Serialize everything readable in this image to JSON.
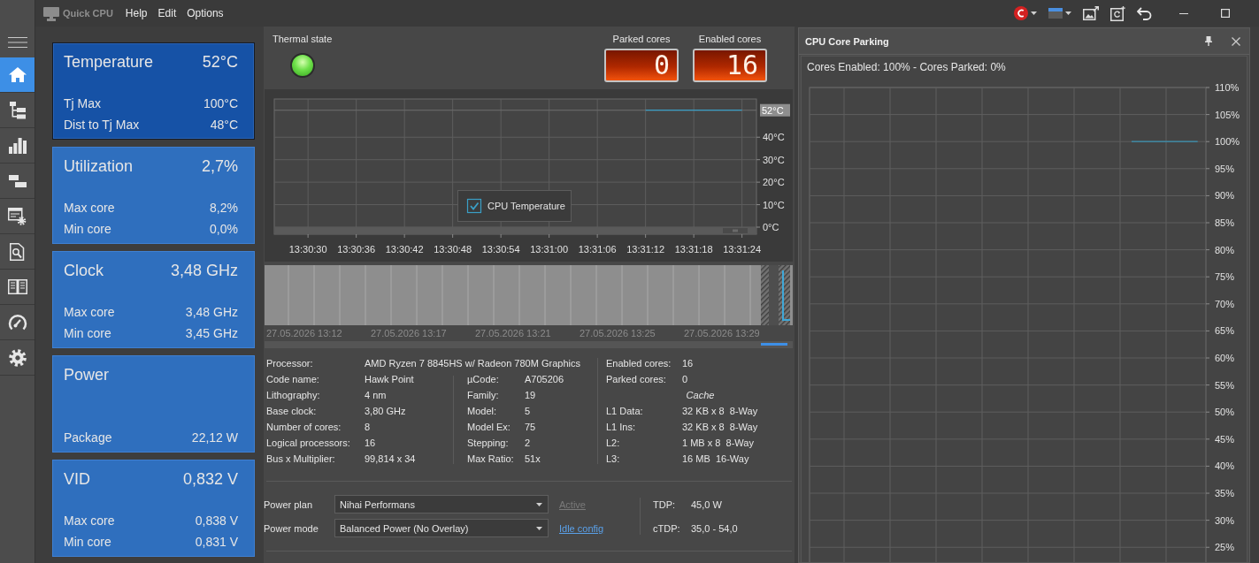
{
  "window": {
    "app_name": "Quick CPU",
    "menu": [
      "Help",
      "Edit",
      "Options"
    ]
  },
  "sidebar": {
    "items": [
      {
        "kind": "home",
        "selected": true
      },
      {
        "kind": "tree",
        "selected": false
      },
      {
        "kind": "chart",
        "selected": false
      },
      {
        "kind": "layers",
        "selected": false
      },
      {
        "kind": "report",
        "selected": false
      },
      {
        "kind": "inspect",
        "selected": false
      },
      {
        "kind": "compare",
        "selected": false
      },
      {
        "kind": "gauge",
        "selected": false
      },
      {
        "kind": "settings",
        "selected": false
      }
    ]
  },
  "cards": [
    {
      "title": "Temperature",
      "value": "52°C",
      "selected": true,
      "rows": [
        {
          "label": "Tj Max",
          "value": "100°C"
        },
        {
          "label": "Dist to Tj Max",
          "value": "48°C"
        }
      ]
    },
    {
      "title": "Utilization",
      "value": "2,7%",
      "selected": false,
      "rows": [
        {
          "label": "Max core",
          "value": "8,2%"
        },
        {
          "label": "Min core",
          "value": "0,0%"
        }
      ]
    },
    {
      "title": "Clock",
      "value": "3,48 GHz",
      "selected": false,
      "rows": [
        {
          "label": "Max core",
          "value": "3,48 GHz"
        },
        {
          "label": "Min core",
          "value": "3,45 GHz"
        }
      ]
    },
    {
      "title": "Power",
      "selected": false,
      "rows": [
        {
          "label": "Package",
          "value": "22,12 W"
        }
      ]
    },
    {
      "title": "VID",
      "value": "0,832 V",
      "selected": false,
      "rows": [
        {
          "label": "Max core",
          "value": "0,838 V"
        },
        {
          "label": "Min core",
          "value": "0,831 V"
        }
      ]
    }
  ],
  "thermal_state": {
    "label": "Thermal state",
    "overheated": false
  },
  "counters": [
    {
      "label": "Parked cores",
      "value": "0"
    },
    {
      "label": "Enabled cores",
      "value": "16"
    }
  ],
  "temperature_chart": {
    "legend_checked": true,
    "chart_data": {
      "type": "line",
      "categories": [
        "13:30:30",
        "13:30:36",
        "13:30:42",
        "13:30:48",
        "13:30:54",
        "13:31:00",
        "13:31:06",
        "13:31:12",
        "13:31:18",
        "13:31:24"
      ],
      "series": [
        {
          "name": "CPU Temperature",
          "color": "#3a9fc6",
          "values": [
            null,
            null,
            null,
            null,
            null,
            null,
            null,
            52,
            52,
            52
          ]
        }
      ],
      "ylim": [
        0,
        57
      ],
      "yticks": [
        {
          "value": 0,
          "label": "0°C"
        },
        {
          "value": 10,
          "label": "10°C"
        },
        {
          "value": 20,
          "label": "20°C"
        },
        {
          "value": 30,
          "label": "30°C"
        },
        {
          "value": 40,
          "label": "40°C"
        }
      ],
      "grid": true,
      "ref_lines": [
        {
          "axis": "y",
          "value": 52
        }
      ],
      "annotations": [
        "52°C"
      ]
    }
  },
  "overview": {
    "date_labels": [
      "27.05.2026 13:12",
      "27.05.2026 13:17",
      "27.05.2026 13:21",
      "27.05.2026 13:25",
      "27.05.2026 13:29"
    ]
  },
  "processor_info": {
    "processor": {
      "label": "Processor:",
      "value": "AMD Ryzen 7 8845HS w/ Radeon 780M Graphics"
    },
    "column_1": [
      {
        "label": "Code name:",
        "value": "Hawk Point"
      },
      {
        "label": "Lithography:",
        "value": "4 nm"
      },
      {
        "label": "Base clock:",
        "value": "3,80 GHz"
      },
      {
        "label": "Number of cores:",
        "value": "8"
      },
      {
        "label": "Logical processors:",
        "value": "16"
      },
      {
        "label": "Bus x Multiplier:",
        "value": "99,814 x 34"
      }
    ],
    "column_2": [
      {
        "label": "µCode:",
        "value": "A705206"
      },
      {
        "label": "Family:",
        "value": "19"
      },
      {
        "label": "Model:",
        "value": "5"
      },
      {
        "label": "Model Ex:",
        "value": "75"
      },
      {
        "label": "Stepping:",
        "value": "2"
      },
      {
        "label": "Max Ratio:",
        "value": "51x"
      }
    ],
    "cores": [
      {
        "label": "Enabled cores:",
        "value": "16"
      },
      {
        "label": "Parked cores:",
        "value": "0"
      }
    ],
    "cache": {
      "title": "Cache",
      "rows": [
        {
          "label": "L1 Data:",
          "value": "32 KB x 8  8-Way"
        },
        {
          "label": "L1 Ins:",
          "value": "32 KB x 8  8-Way"
        },
        {
          "label": "L2:",
          "value": "1 MB x 8  8-Way"
        },
        {
          "label": "L3:",
          "value": "16 MB  16-Way"
        }
      ]
    }
  },
  "power": {
    "rows": [
      {
        "label": "Power plan",
        "value": "Nihai Performans",
        "link": {
          "text": "Active",
          "disabled": true
        }
      },
      {
        "label": "Power mode",
        "value": "Balanced Power (No Overlay)",
        "link": {
          "text": "Idle config",
          "disabled": false
        }
      }
    ],
    "tdp": [
      {
        "label": "TDP:",
        "value": "45,0 W"
      },
      {
        "label": "cTDP:",
        "value": "35,0 - 54,0"
      }
    ]
  },
  "core_parking": {
    "title": "CPU Core Parking",
    "summary": "Cores Enabled: 100% - Cores Parked: 0%",
    "chart_data": {
      "type": "line",
      "categories": [
        null,
        null,
        null,
        null,
        null,
        null,
        null,
        null,
        null,
        null,
        null,
        null,
        null,
        null,
        null,
        null,
        null,
        null,
        null,
        null,
        null,
        null,
        null,
        null
      ],
      "values": [
        null,
        null,
        null,
        null,
        null,
        null,
        null,
        null,
        null,
        null,
        null,
        null,
        null,
        null,
        null,
        null,
        null,
        null,
        null,
        100,
        100,
        100,
        100,
        100
      ],
      "ylim": [
        22,
        110
      ],
      "yticks": [
        {
          "value": 110,
          "label": "110%"
        },
        {
          "value": 105,
          "label": "105%"
        },
        {
          "value": 100,
          "label": "100%"
        },
        {
          "value": 95,
          "label": "95%"
        },
        {
          "value": 90,
          "label": "90%"
        },
        {
          "value": 85,
          "label": "85%"
        },
        {
          "value": 80,
          "label": "80%"
        },
        {
          "value": 75,
          "label": "75%"
        },
        {
          "value": 70,
          "label": "70%"
        },
        {
          "value": 65,
          "label": "65%"
        },
        {
          "value": 60,
          "label": "60%"
        },
        {
          "value": 55,
          "label": "55%"
        },
        {
          "value": 50,
          "label": "50%"
        },
        {
          "value": 45,
          "label": "45%"
        },
        {
          "value": 40,
          "label": "40%"
        },
        {
          "value": 35,
          "label": "35%"
        },
        {
          "value": 30,
          "label": "30%"
        },
        {
          "value": 25,
          "label": "25%"
        }
      ],
      "grid": true
    }
  }
}
